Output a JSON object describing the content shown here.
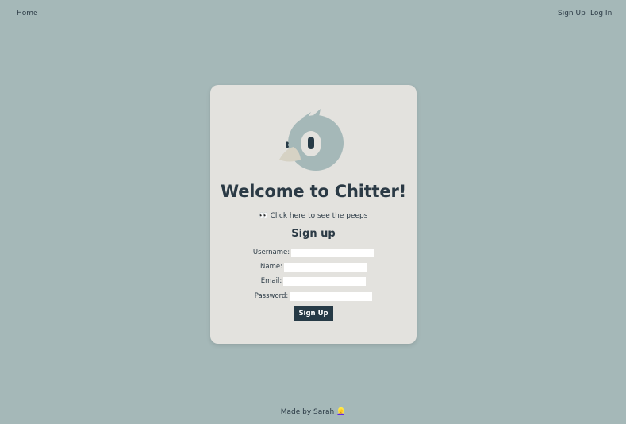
{
  "nav": {
    "home": "Home",
    "signup": "Sign Up",
    "login": "Log In"
  },
  "card": {
    "logo_icon": "bird-logo-icon",
    "title": "Welcome to Chitter!",
    "peeps_link": "👀 Click here to see the peeps",
    "form_title": "Sign up",
    "fields": {
      "username_label": "Username:",
      "name_label": "Name:",
      "email_label": "Email:",
      "password_label": "Password:",
      "username_value": "",
      "name_value": "",
      "email_value": "",
      "password_value": ""
    },
    "submit_label": "Sign Up"
  },
  "footer": {
    "text": "Made by Sarah 👱‍♀️"
  },
  "colors": {
    "background": "#a5b8b8",
    "card": "#e3e2de",
    "primary": "#263a46",
    "bird": "#a5b8b8",
    "beak": "#d6d2c4"
  }
}
